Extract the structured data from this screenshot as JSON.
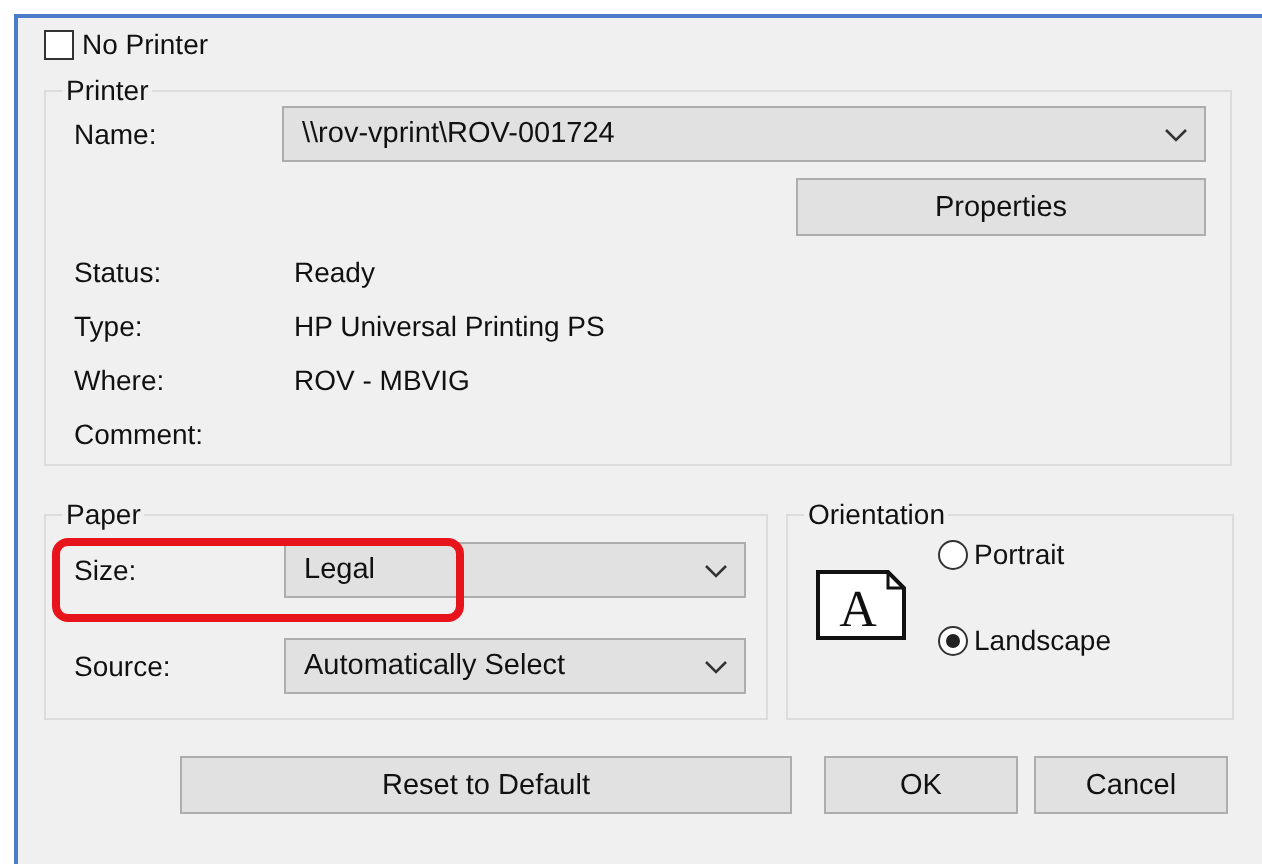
{
  "no_printer": {
    "label": "No Printer",
    "checked": false
  },
  "printer": {
    "title": "Printer",
    "name": {
      "label": "Name:",
      "value": "\\\\rov-vprint\\ROV-001724"
    },
    "properties_button": "Properties",
    "info": [
      {
        "label": "Status:",
        "value": "Ready"
      },
      {
        "label": "Type:",
        "value": "HP Universal Printing PS"
      },
      {
        "label": "Where:",
        "value": "ROV - MBVIG"
      },
      {
        "label": "Comment:"
      }
    ]
  },
  "paper": {
    "title": "Paper",
    "fields": [
      {
        "label": "Size:",
        "value": "Legal",
        "highlighted": true
      },
      {
        "label": "Source:",
        "value": "Automatically Select",
        "highlighted": false
      }
    ]
  },
  "orientation": {
    "title": "Orientation",
    "icon_letter": "A",
    "options": [
      {
        "label": "Portrait",
        "selected": false
      },
      {
        "label": "Landscape",
        "selected": true
      }
    ]
  },
  "buttons": [
    {
      "label": "Reset to Default"
    },
    {
      "label": "OK"
    },
    {
      "label": "Cancel"
    }
  ]
}
